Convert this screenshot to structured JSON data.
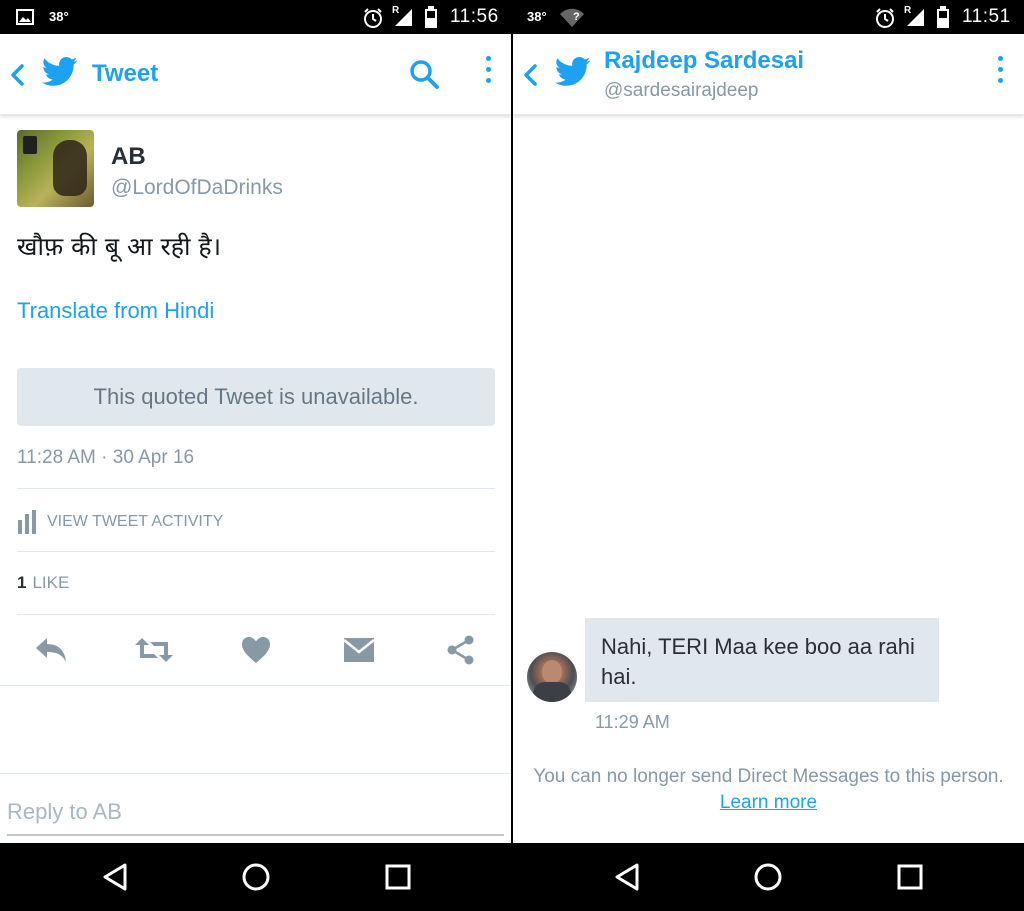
{
  "left": {
    "status": {
      "temp": "38°",
      "time": "11:56",
      "roaming": "R"
    },
    "appbar": {
      "title": "Tweet"
    },
    "tweet": {
      "name": "AB",
      "handle": "@LordOfDaDrinks",
      "text": "खौफ़ की बू आ रही है।",
      "translate_label": "Translate from Hindi",
      "quoted_unavailable": "This quoted Tweet is unavailable.",
      "timestamp": "11:28 AM · 30 Apr 16",
      "activity_label": "VIEW TWEET ACTIVITY",
      "like_count": "1",
      "like_label": "LIKE"
    },
    "reply": {
      "placeholder": "Reply to AB"
    }
  },
  "right": {
    "status": {
      "temp": "38°",
      "time": "11:51",
      "roaming": "R",
      "wifi_unknown": "?"
    },
    "appbar": {
      "title": "Rajdeep Sardesai",
      "subtitle": "@sardesairajdeep"
    },
    "message": {
      "text": "Nahi, TERI Maa kee boo aa rahi hai.",
      "time": "11:29 AM"
    },
    "notice": {
      "text": "You can no longer send Direct Messages to this person.",
      "link": "Learn more"
    }
  },
  "colors": {
    "accent": "#1DA1F2",
    "muted": "#8899a6",
    "bubble": "#e1e8ed"
  }
}
